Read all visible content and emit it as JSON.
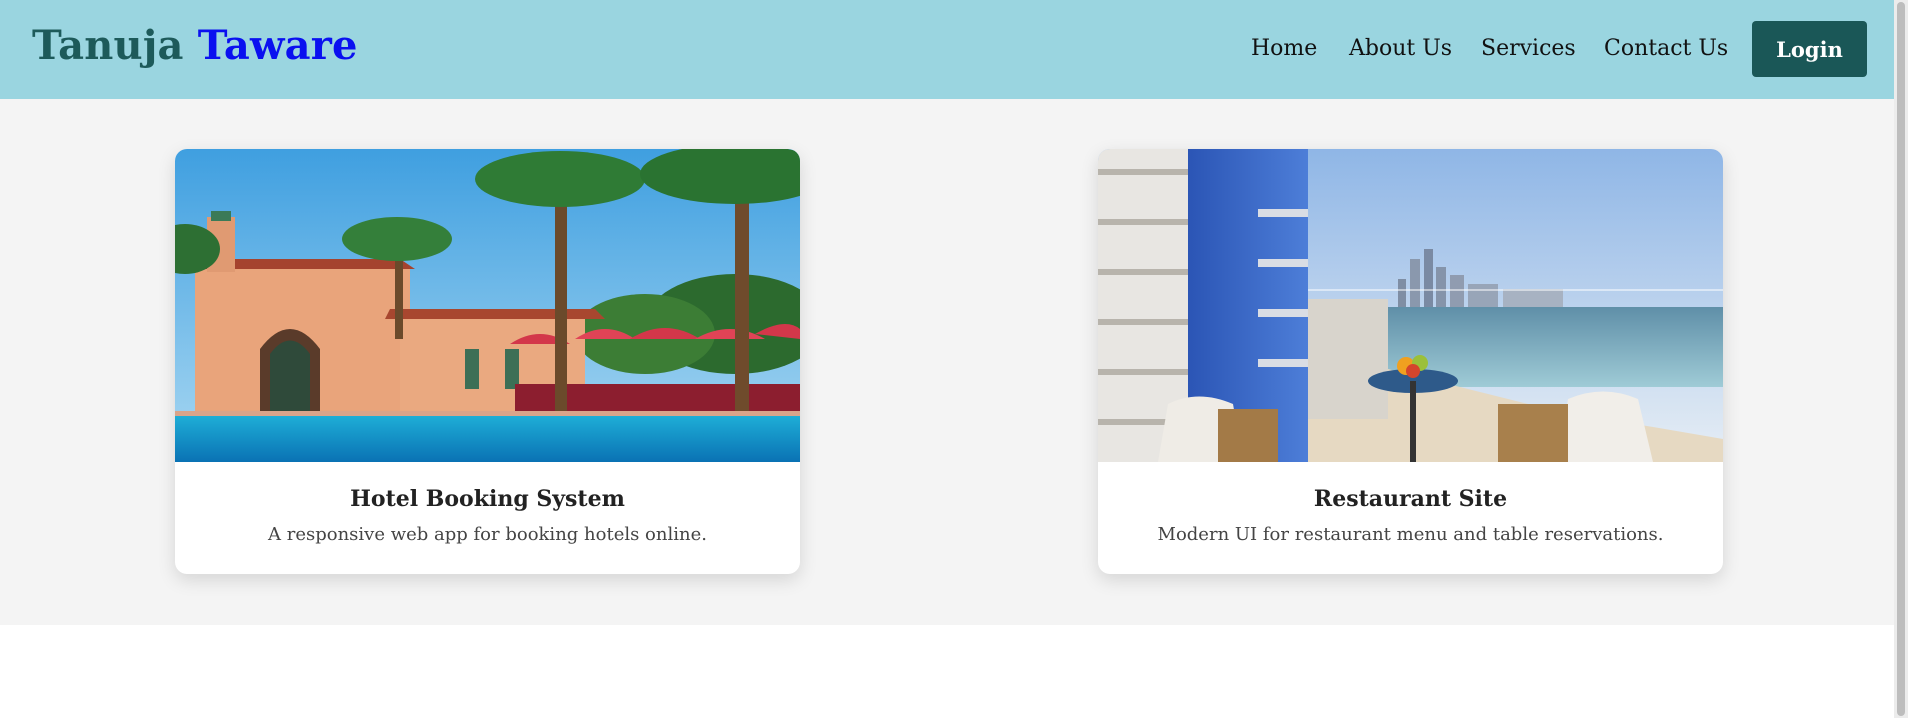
{
  "brand": {
    "first": "Tanuja",
    "last": "Taware"
  },
  "nav": {
    "links": [
      "Home",
      "About Us",
      "Services",
      "Contact Us"
    ],
    "login_label": "Login"
  },
  "projects": [
    {
      "title": "Hotel Booking System",
      "description": "A responsive web app for booking hotels online.",
      "image": "resort-pool-palms"
    },
    {
      "title": "Restaurant Site",
      "description": "Modern UI for restaurant menu and table reservations.",
      "image": "balcony-sea-skyline"
    }
  ],
  "colors": {
    "navbar": "#9ad5e0",
    "brand_first": "#1d5a5a",
    "brand_last": "#0a10f0",
    "login_button": "#1a5757",
    "section_bg": "#f4f4f4"
  }
}
